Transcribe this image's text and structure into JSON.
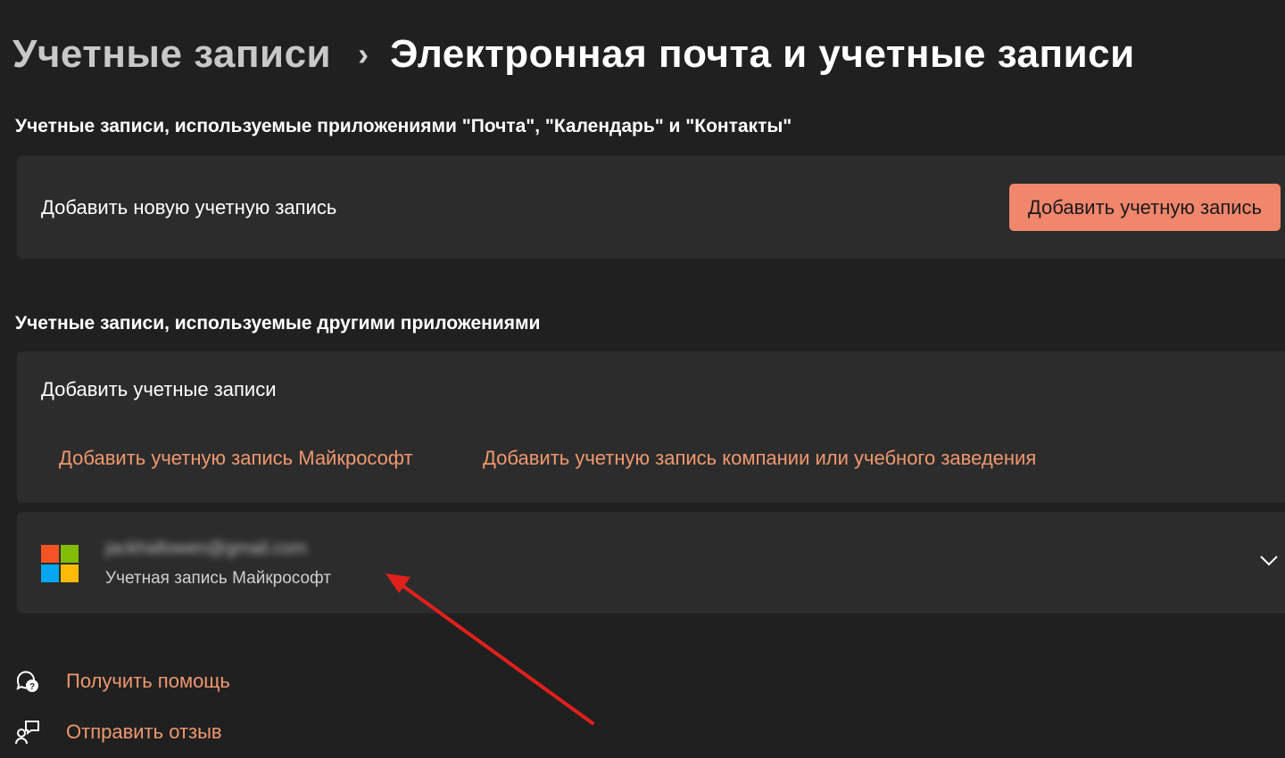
{
  "breadcrumb": {
    "parent": "Учетные записи",
    "separator": "›",
    "current": "Электронная почта и учетные записи"
  },
  "section_mail": {
    "title": "Учетные записи, используемые приложениями \"Почта\", \"Календарь\" и \"Контакты\"",
    "card_label": "Добавить новую учетную запись",
    "button_label": "Добавить учетную запись"
  },
  "section_other": {
    "title": "Учетные записи, используемые другими приложениями",
    "card_label": "Добавить учетные записи",
    "link_microsoft": "Добавить учетную запись Майкрософт",
    "link_work": "Добавить учетную запись компании или учебного заведения"
  },
  "account": {
    "email": "jackhallowen@gmail.com",
    "type": "Учетная запись Майкрософт",
    "icon": "microsoft-logo",
    "logo_colors": [
      "#f35325",
      "#81bc06",
      "#05a6f0",
      "#ffba08"
    ]
  },
  "footer": {
    "help_label": "Получить помощь",
    "help_icon": "help-chat-icon",
    "feedback_label": "Отправить отзыв",
    "feedback_icon": "feedback-icon"
  },
  "colors": {
    "background": "#202020",
    "card": "#2c2c2c",
    "accent": "#f0866c",
    "link": "#f0986f",
    "annotation_arrow": "#e0201b"
  }
}
